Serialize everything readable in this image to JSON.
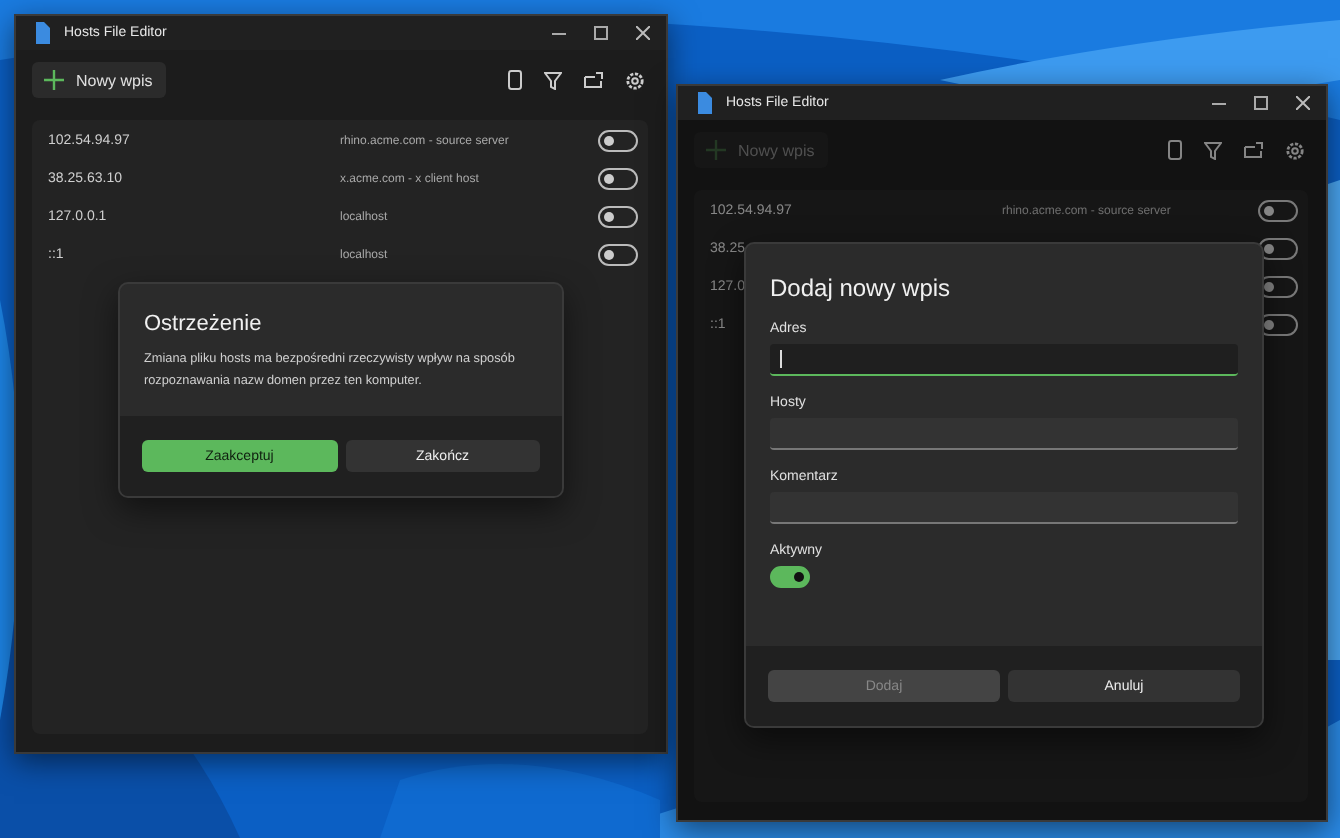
{
  "windows": [
    {
      "title": "Hosts File Editor",
      "toolbar": {
        "new_entry": "Nowy wpis",
        "disabled": false
      },
      "entries": [
        {
          "address": "102.54.94.97",
          "hosts": "rhino.acme.com - source server",
          "active": false
        },
        {
          "address": "38.25.63.10",
          "hosts": "x.acme.com - x client host",
          "active": false
        },
        {
          "address": "127.0.0.1",
          "hosts": "localhost",
          "active": false
        },
        {
          "address": "::1",
          "hosts": "localhost",
          "active": false
        }
      ],
      "dialog": {
        "kind": "warning",
        "title": "Ostrzeżenie",
        "message": "Zmiana pliku hosts ma bezpośredni rzeczywisty wpływ na sposób rozpoznawania nazw domen przez ten komputer.",
        "buttons": [
          {
            "label": "Zaakceptuj",
            "kind": "accent"
          },
          {
            "label": "Zakończ",
            "kind": "standard"
          }
        ]
      }
    },
    {
      "title": "Hosts File Editor",
      "toolbar": {
        "new_entry": "Nowy wpis",
        "disabled": true
      },
      "entries": [
        {
          "address": "102.54.94.97",
          "hosts": "rhino.acme.com - source server",
          "active": false
        },
        {
          "address": "38.25",
          "active": false
        },
        {
          "address": "127.0",
          "active": false
        },
        {
          "address": "::1",
          "active": false
        }
      ],
      "dialog": {
        "kind": "form",
        "title": "Dodaj nowy wpis",
        "fields": [
          {
            "label": "Adres",
            "focused": true
          },
          {
            "label": "Hosty",
            "focused": false
          },
          {
            "label": "Komentarz",
            "focused": false
          }
        ],
        "switch": {
          "label": "Aktywny",
          "on": true
        },
        "buttons": [
          {
            "label": "Dodaj",
            "kind": "disabled"
          },
          {
            "label": "Anuluj",
            "kind": "standard"
          }
        ]
      }
    }
  ]
}
